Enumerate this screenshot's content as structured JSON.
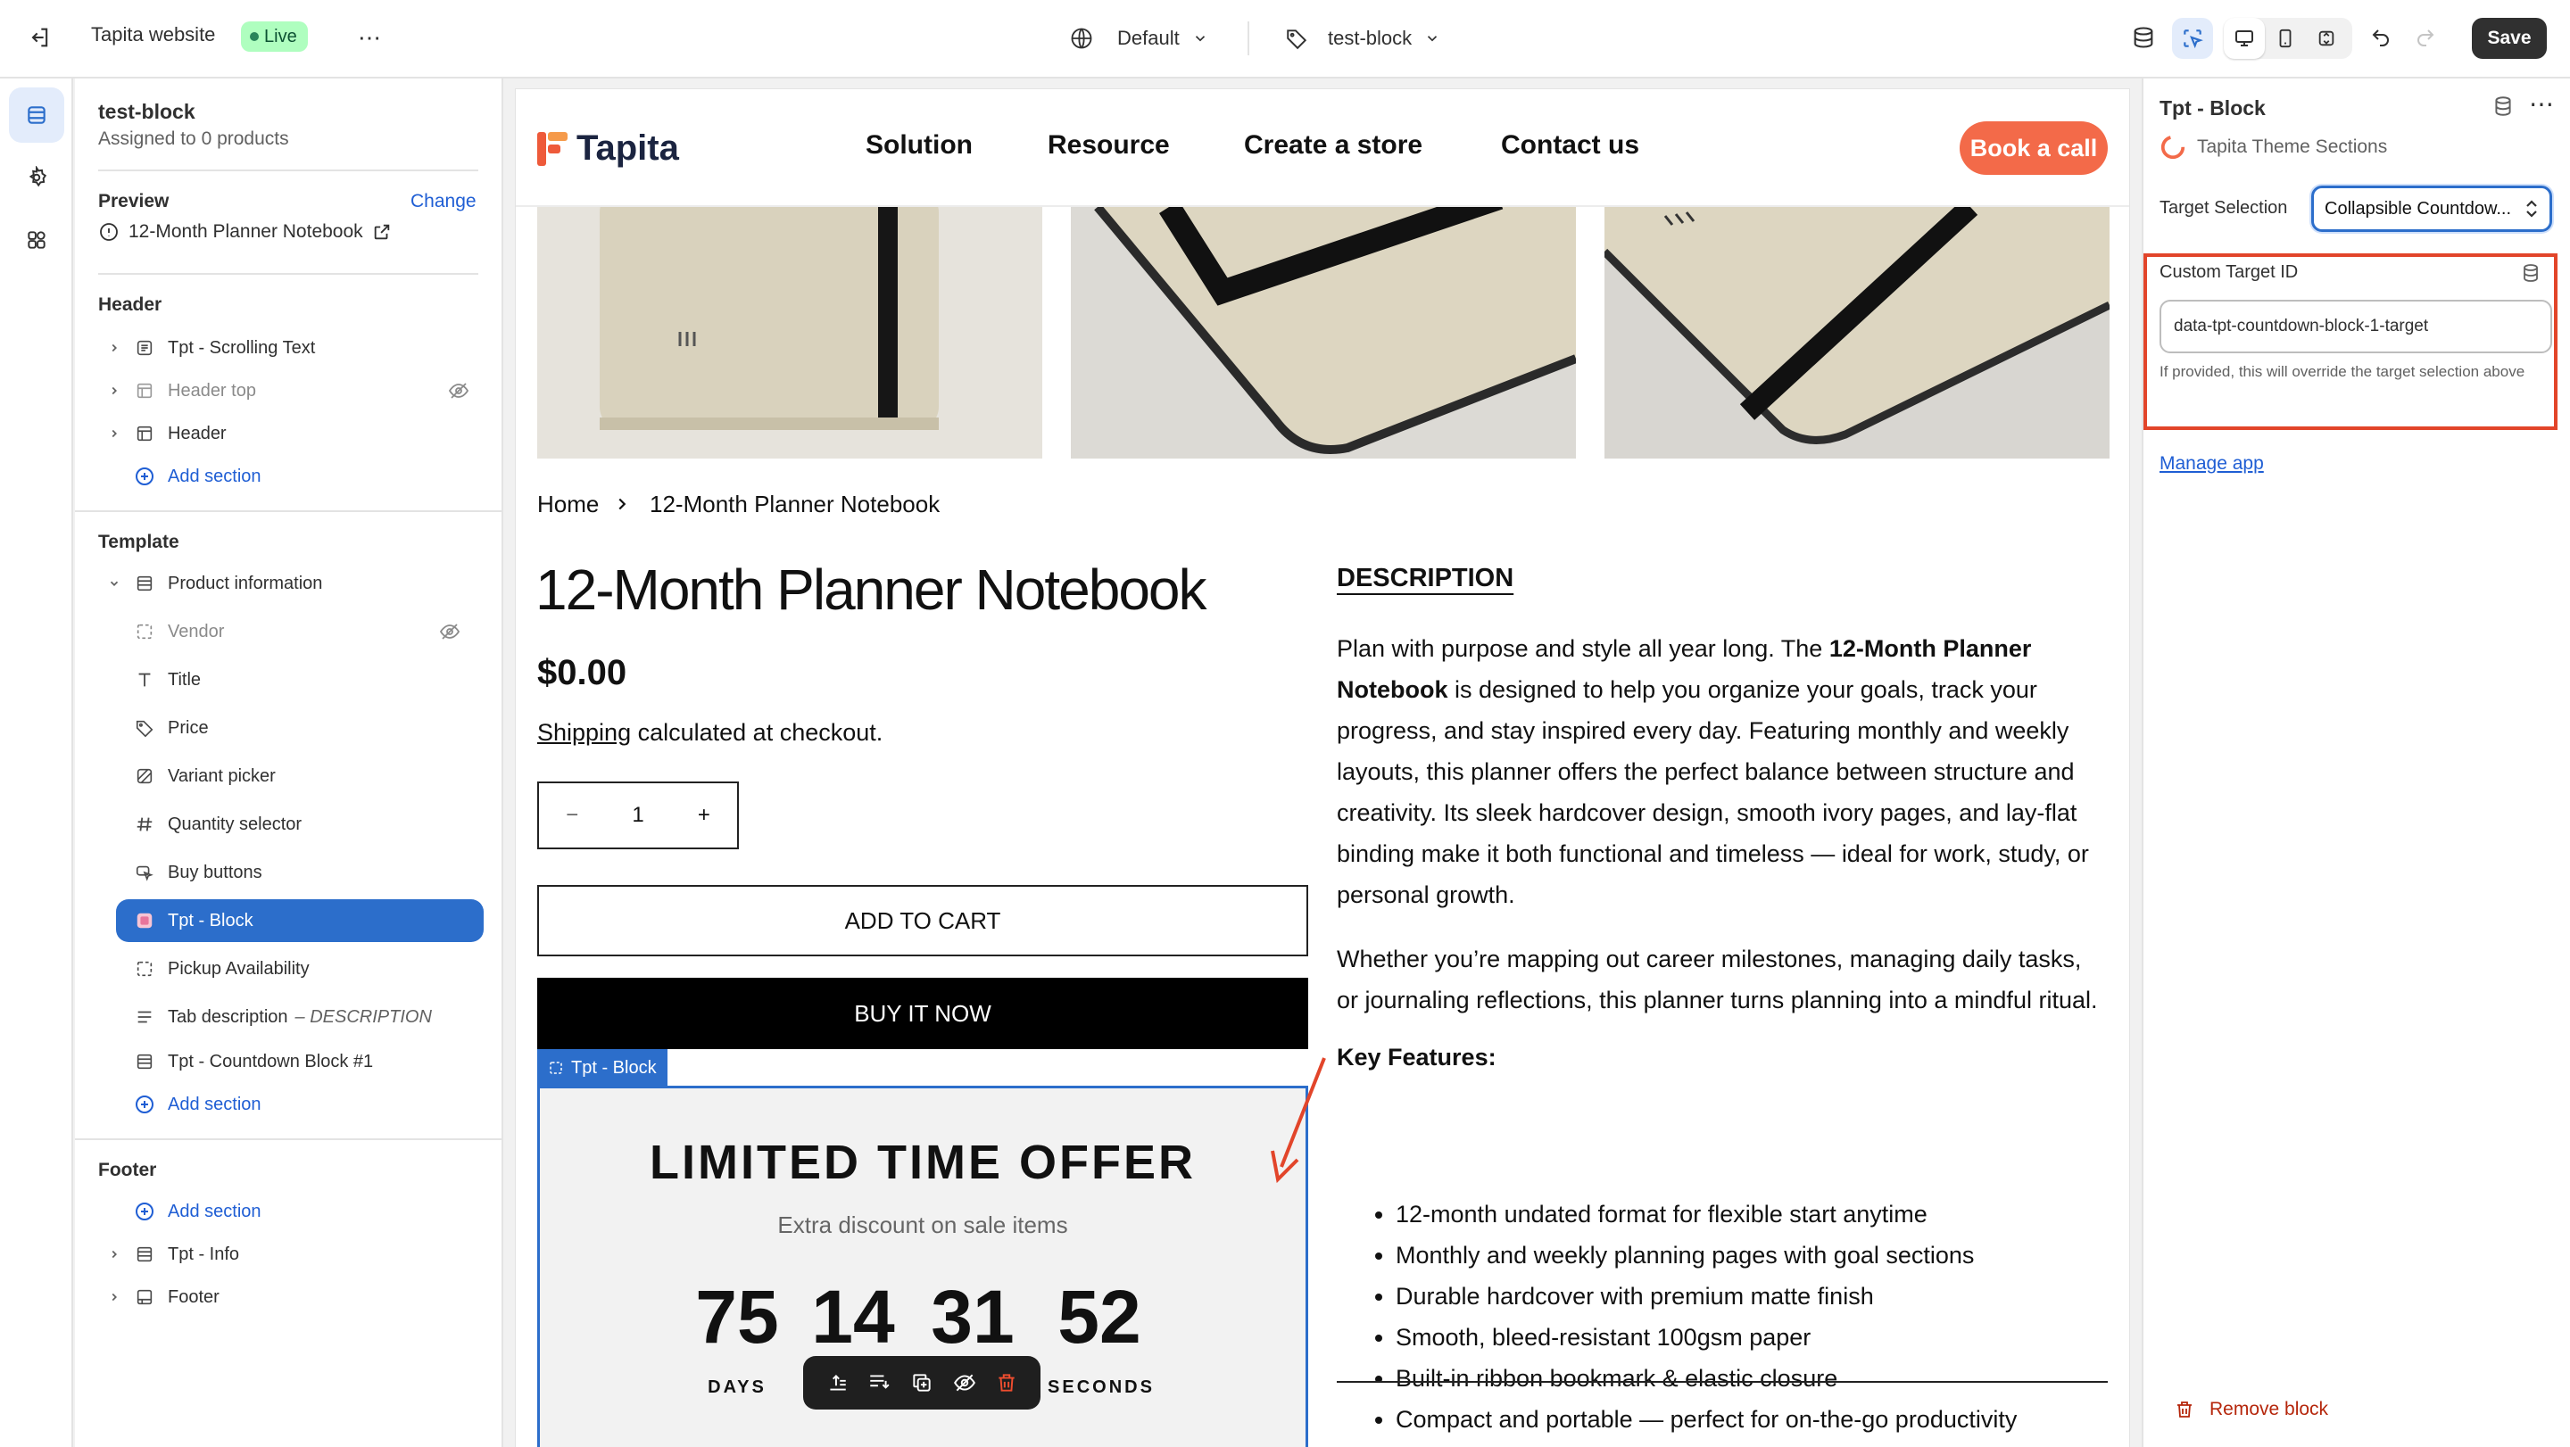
{
  "topbar": {
    "store_name": "Tapita website",
    "status_badge": "Live",
    "theme_select": "Default",
    "template_select": "test-block",
    "save_label": "Save"
  },
  "sidebar": {
    "template_name": "test-block",
    "assigned": "Assigned to 0 products",
    "preview_label": "Preview",
    "change_label": "Change",
    "preview_product": "12-Month Planner Notebook",
    "header_group": {
      "title": "Header",
      "items": [
        "Tpt - Scrolling Text",
        "Header top",
        "Header"
      ],
      "add": "Add section"
    },
    "template_group": {
      "title": "Template",
      "section": "Product information",
      "blocks": [
        "Vendor",
        "Title",
        "Price",
        "Variant picker",
        "Quantity selector",
        "Buy buttons",
        "Tpt - Block",
        "Pickup Availability"
      ],
      "tab_desc": "Tab description",
      "tab_desc_suffix": "– DESCRIPTION",
      "countdown": "Tpt - Countdown Block #1",
      "add": "Add section"
    },
    "footer_group": {
      "title": "Footer",
      "add": "Add section",
      "items": [
        "Tpt - Info",
        "Footer"
      ]
    }
  },
  "site": {
    "logo": "Tapita",
    "nav": [
      "Solution",
      "Resource",
      "Create a store",
      "Contact us"
    ],
    "cta": "Book a call",
    "breadcrumb_home": "Home",
    "breadcrumb_current": "12-Month Planner Notebook",
    "product_title": "12-Month Planner Notebook",
    "price": "$0.00",
    "shipping_link": "Shipping",
    "shipping_text": " calculated at checkout.",
    "qty_minus": "−",
    "qty_value": "1",
    "qty_plus": "+",
    "add_to_cart": "ADD TO CART",
    "buy_now": "BUY IT NOW",
    "tpt_tag": "Tpt - Block",
    "offer_title": "LIMITED TIME OFFER",
    "offer_sub": "Extra discount on sale items",
    "countdown": [
      {
        "value": "75",
        "label": "DAYS"
      },
      {
        "value": "14",
        "label": ""
      },
      {
        "value": "31",
        "label": ""
      },
      {
        "value": "52",
        "label": "SECONDS"
      }
    ],
    "desc_heading": "DESCRIPTION",
    "desc_p1_a": "Plan with purpose and style all year long. The ",
    "desc_p1_b": "12-Month Planner Notebook",
    "desc_p1_c": " is designed to help you organize your goals, track your progress, and stay inspired every day. Featuring monthly and weekly layouts, this planner offers the perfect balance between structure and creativity. Its sleek hardcover design, smooth ivory pages, and lay-flat binding make it both functional and timeless — ideal for work, study, or personal growth.",
    "desc_p2": "Whether you’re mapping out career milestones, managing daily tasks, or journaling reflections, this planner turns planning into a mindful ritual.",
    "key_features": "Key Features:",
    "features": [
      "12-month undated format for flexible start anytime",
      "Monthly and weekly planning pages with goal sections",
      "Durable hardcover with premium matte finish",
      "Smooth, bleed-resistant 100gsm paper",
      "Built-in ribbon bookmark & elastic closure",
      "Compact and portable — perfect for on-the-go productivity"
    ]
  },
  "inspector": {
    "title": "Tpt - Block",
    "app_name": "Tapita Theme Sections",
    "target_label": "Target Selection",
    "target_value": "Collapsible Countdow...",
    "custom_label": "Custom Target ID",
    "custom_value": "data-tpt-countdown-block-1-target",
    "help": "If provided, this will override the target selection above",
    "manage": "Manage app",
    "remove": "Remove block"
  },
  "colors": {
    "accent": "#2c6ecb",
    "brand_orange": "#f36a49",
    "highlight_red": "#e2452a",
    "live_green": "#affebf"
  }
}
